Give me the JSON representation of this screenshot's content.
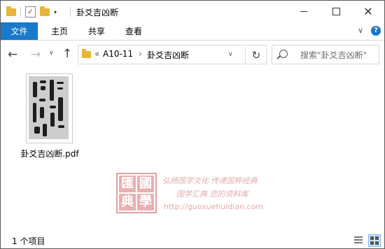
{
  "window": {
    "title": "卦爻吉凶断",
    "minimize_icon": "minimize-icon",
    "maximize_icon": "maximize-icon",
    "close_glyph": "✕"
  },
  "ribbon": {
    "tabs": [
      {
        "label": "文件",
        "active": true
      },
      {
        "label": "主页"
      },
      {
        "label": "共享"
      },
      {
        "label": "查看"
      }
    ],
    "expand_glyph": "∨",
    "help_glyph": "?"
  },
  "nav": {
    "back_glyph": "←",
    "forward_glyph": "→",
    "recent_glyph": "∨",
    "up_glyph": "↑",
    "address": {
      "overflow_glyph": "«",
      "parts": [
        "A10-11",
        "卦爻吉凶断"
      ],
      "separator_glyph": "›",
      "dropdown_glyph": "∨",
      "refresh_glyph": "↻"
    },
    "search": {
      "placeholder": "搜索\"卦爻吉凶断\""
    }
  },
  "files": [
    {
      "name": "卦爻吉凶断.pdf"
    }
  ],
  "watermark": {
    "seal_chars": [
      "匯",
      "國",
      "典",
      "學"
    ],
    "line1": "弘扬国学文化  传递国粹经典",
    "line2": "国学汇典 您的资料库",
    "url": "http://guoxuehuidian.com"
  },
  "status": {
    "item_count": "1 个项目"
  },
  "colors": {
    "accent": "#1979ca",
    "folder": "#e7b53b",
    "watermark": "#e2a3a3"
  }
}
